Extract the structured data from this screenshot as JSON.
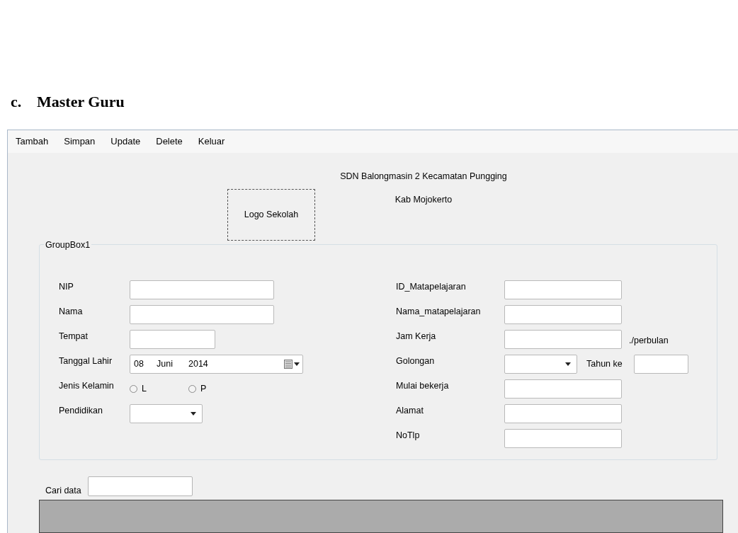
{
  "heading": {
    "marker": "c.",
    "text": "Master Guru"
  },
  "menu": [
    "Tambah",
    "Simpan",
    "Update",
    "Delete",
    "Keluar"
  ],
  "logo": {
    "label": "Logo Sekolah"
  },
  "school": [
    "SDN Balongmasin 2 Kecamatan Pungging",
    "Kab Mojokerto"
  ],
  "groupbox": {
    "title": "GroupBox1",
    "left": [
      {
        "kind": "text",
        "label": "NIP"
      },
      {
        "kind": "text",
        "label": "Nama"
      },
      {
        "kind": "short_text",
        "label": "Tempat"
      },
      {
        "kind": "date",
        "label": "Tanggal Lahir",
        "day": "08",
        "month": "Juni",
        "year": "2014"
      },
      {
        "kind": "radio",
        "label": "Jenis Kelamin",
        "options": [
          {
            "label": "L",
            "selected": false
          },
          {
            "label": "P",
            "selected": false
          }
        ]
      },
      {
        "kind": "combo",
        "label": "Pendidikan"
      }
    ],
    "right": [
      {
        "kind": "text",
        "label": "ID_Matapelajaran"
      },
      {
        "kind": "text",
        "label": "Nama_matapelajaran"
      },
      {
        "kind": "text",
        "label": "Jam Kerja",
        "suffix": "./perbulan"
      },
      {
        "kind": "combo",
        "label": "Golongan",
        "extra_label": "Tahun ke"
      },
      {
        "kind": "text",
        "label": "Mulai bekerja"
      },
      {
        "kind": "text",
        "label": "Alamat"
      },
      {
        "kind": "text",
        "label": "NoTlp"
      }
    ]
  },
  "search": {
    "label": "Cari data"
  }
}
